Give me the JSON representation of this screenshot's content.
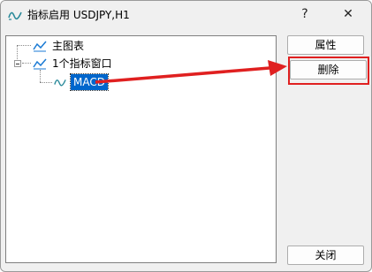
{
  "window": {
    "title": "指标启用 USDJPY,H1",
    "help_label": "?",
    "close_label": "✕"
  },
  "tree": {
    "items": [
      {
        "label": "主图表"
      },
      {
        "label": "1个指标窗口",
        "expanded": true
      },
      {
        "label": "MACD",
        "selected": true
      }
    ]
  },
  "buttons": {
    "properties": "属性",
    "delete": "删除",
    "close": "关闭"
  },
  "annotation": {
    "color": "#e02020"
  }
}
